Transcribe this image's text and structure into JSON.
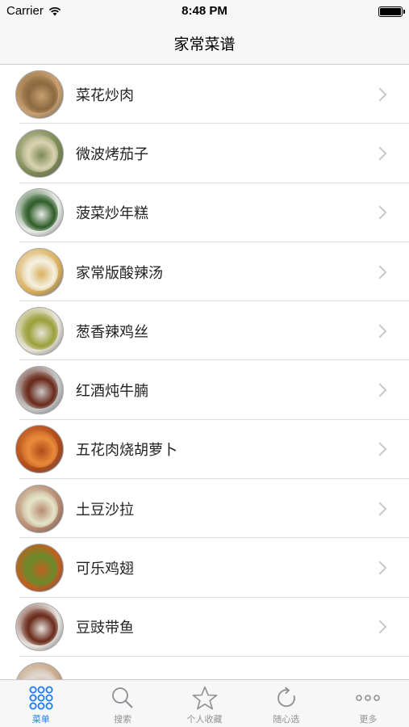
{
  "status_bar": {
    "carrier": "Carrier",
    "time": "8:48 PM",
    "battery_level": 1.0
  },
  "nav": {
    "title": "家常菜谱"
  },
  "dishes": [
    {
      "name": "菜花炒肉",
      "color": "#c9a070",
      "accent": "#8a6a40"
    },
    {
      "name": "微波烤茄子",
      "color": "#7d8a55",
      "accent": "#d8d2b0"
    },
    {
      "name": "菠菜炒年糕",
      "color": "#e8ece6",
      "accent": "#2f5e2a"
    },
    {
      "name": "家常版酸辣汤",
      "color": "#d9b060",
      "accent": "#f5f0e0"
    },
    {
      "name": "葱香辣鸡丝",
      "color": "#e8e4d8",
      "accent": "#9aa03a"
    },
    {
      "name": "红酒炖牛腩",
      "color": "#c8c8c8",
      "accent": "#6a2a1a"
    },
    {
      "name": "五花肉烧胡萝卜",
      "color": "#b04a1a",
      "accent": "#e88a3a"
    },
    {
      "name": "土豆沙拉",
      "color": "#b88a70",
      "accent": "#e4e4c8"
    },
    {
      "name": "可乐鸡翅",
      "color": "#c06020",
      "accent": "#6a8a2a"
    },
    {
      "name": "豆豉带鱼",
      "color": "#e8e4e0",
      "accent": "#6a2a1a"
    },
    {
      "name": "",
      "color": "#c8a888",
      "accent": "#e0d8d0"
    }
  ],
  "tabs": [
    {
      "label": "菜单",
      "icon": "grid-icon",
      "active": true
    },
    {
      "label": "搜索",
      "icon": "search-icon",
      "active": false
    },
    {
      "label": "个人收藏",
      "icon": "star-icon",
      "active": false
    },
    {
      "label": "随心选",
      "icon": "refresh-icon",
      "active": false
    },
    {
      "label": "更多",
      "icon": "more-icon",
      "active": false
    }
  ],
  "colors": {
    "accent": "#1a7cf4",
    "inactive": "#929292",
    "separator": "#dcdcdf"
  }
}
